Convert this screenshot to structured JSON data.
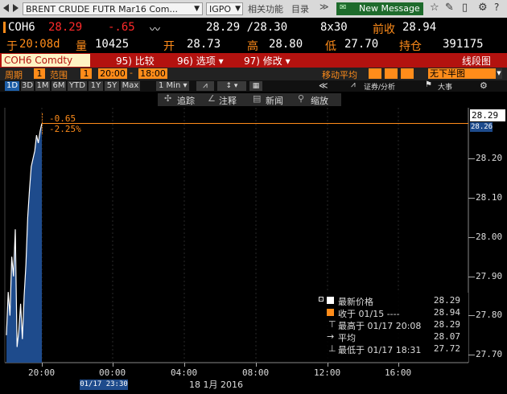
{
  "toolbar": {
    "security": "BRENT CRUDE FUTR Mar16 Com...",
    "function": "IGPO",
    "related": "相关功能",
    "catalog": "目录",
    "message": "New Message"
  },
  "quote": {
    "ticker": "COH6",
    "last": "28.29",
    "change": "-.65",
    "bidask": "28.29 /28.30",
    "size": "8x30",
    "prev_close_label": "前收",
    "prev_close": "28.94",
    "time_label": "于",
    "time": "20:08d",
    "volume_label": "量",
    "volume": "10425",
    "open_label": "开",
    "open": "28.73",
    "high_label": "高",
    "high": "28.80",
    "low_label": "低",
    "low": "27.70",
    "oi_label": "持仓",
    "oi": "391175"
  },
  "menubar": {
    "security": "COH6 Comdty",
    "compare": "95) 比较",
    "options": "96) 选项 ▾",
    "modify": "97) 修改 ▾",
    "chart_type": "线段图"
  },
  "params": {
    "period_label": "周期",
    "period_value": "1",
    "range_label": "范围",
    "range_value": "1",
    "time_from": "20:00",
    "time_to": "18:00",
    "ma_label": "移动平均",
    "overlay": "无下半图"
  },
  "zoombar": {
    "buttons": [
      "1D",
      "3D",
      "1M",
      "6M",
      "YTD",
      "1Y",
      "5Y",
      "Max"
    ],
    "interval": "1 Min ▾",
    "news_analysis": "证券/分析",
    "events": "大事"
  },
  "tools": {
    "track": "追踪",
    "annotate": "注释",
    "news": "新闻",
    "zoom": "缩放"
  },
  "chart_annotation": {
    "change": "-0.65",
    "pct": "-2.25%"
  },
  "legend": {
    "last_label": "最新价格",
    "last_value": "28.29",
    "close_label": "收于 01/15 ----",
    "close_value": "28.94",
    "high_label": "最高于 01/17 20:08",
    "high_value": "28.29",
    "avg_label": "平均",
    "avg_value": "28.07",
    "low_label": "最低于 01/17 18:31",
    "low_value": "27.72"
  },
  "axis": {
    "x_date_tag": "01/17 23:30",
    "x_date": "18 1月 2016",
    "last_tag": "28.29",
    "sub_tag": "28.26"
  },
  "chart_data": {
    "type": "area",
    "y_ticks": [
      "28.20",
      "28.10",
      "28.00",
      "27.90",
      "27.80",
      "27.70"
    ],
    "x_ticks": [
      "20:00",
      "00:00",
      "04:00",
      "08:00",
      "12:00",
      "16:00"
    ],
    "ylim": [
      27.68,
      28.33
    ],
    "reference_line": 28.29,
    "series": [
      {
        "values": [
          27.75,
          27.86,
          27.8,
          27.95,
          27.9,
          28.02,
          27.72,
          27.76,
          27.83,
          27.74,
          27.85,
          27.93,
          28.05,
          28.12,
          28.18,
          28.2,
          28.22,
          28.26,
          28.24,
          28.27,
          28.29
        ]
      }
    ]
  },
  "colors": {
    "accent": "#ff8c1a",
    "red": "#ff2a2a",
    "area": "#1e4b8c",
    "line": "#ffffff",
    "menubar": "#b3120f"
  }
}
